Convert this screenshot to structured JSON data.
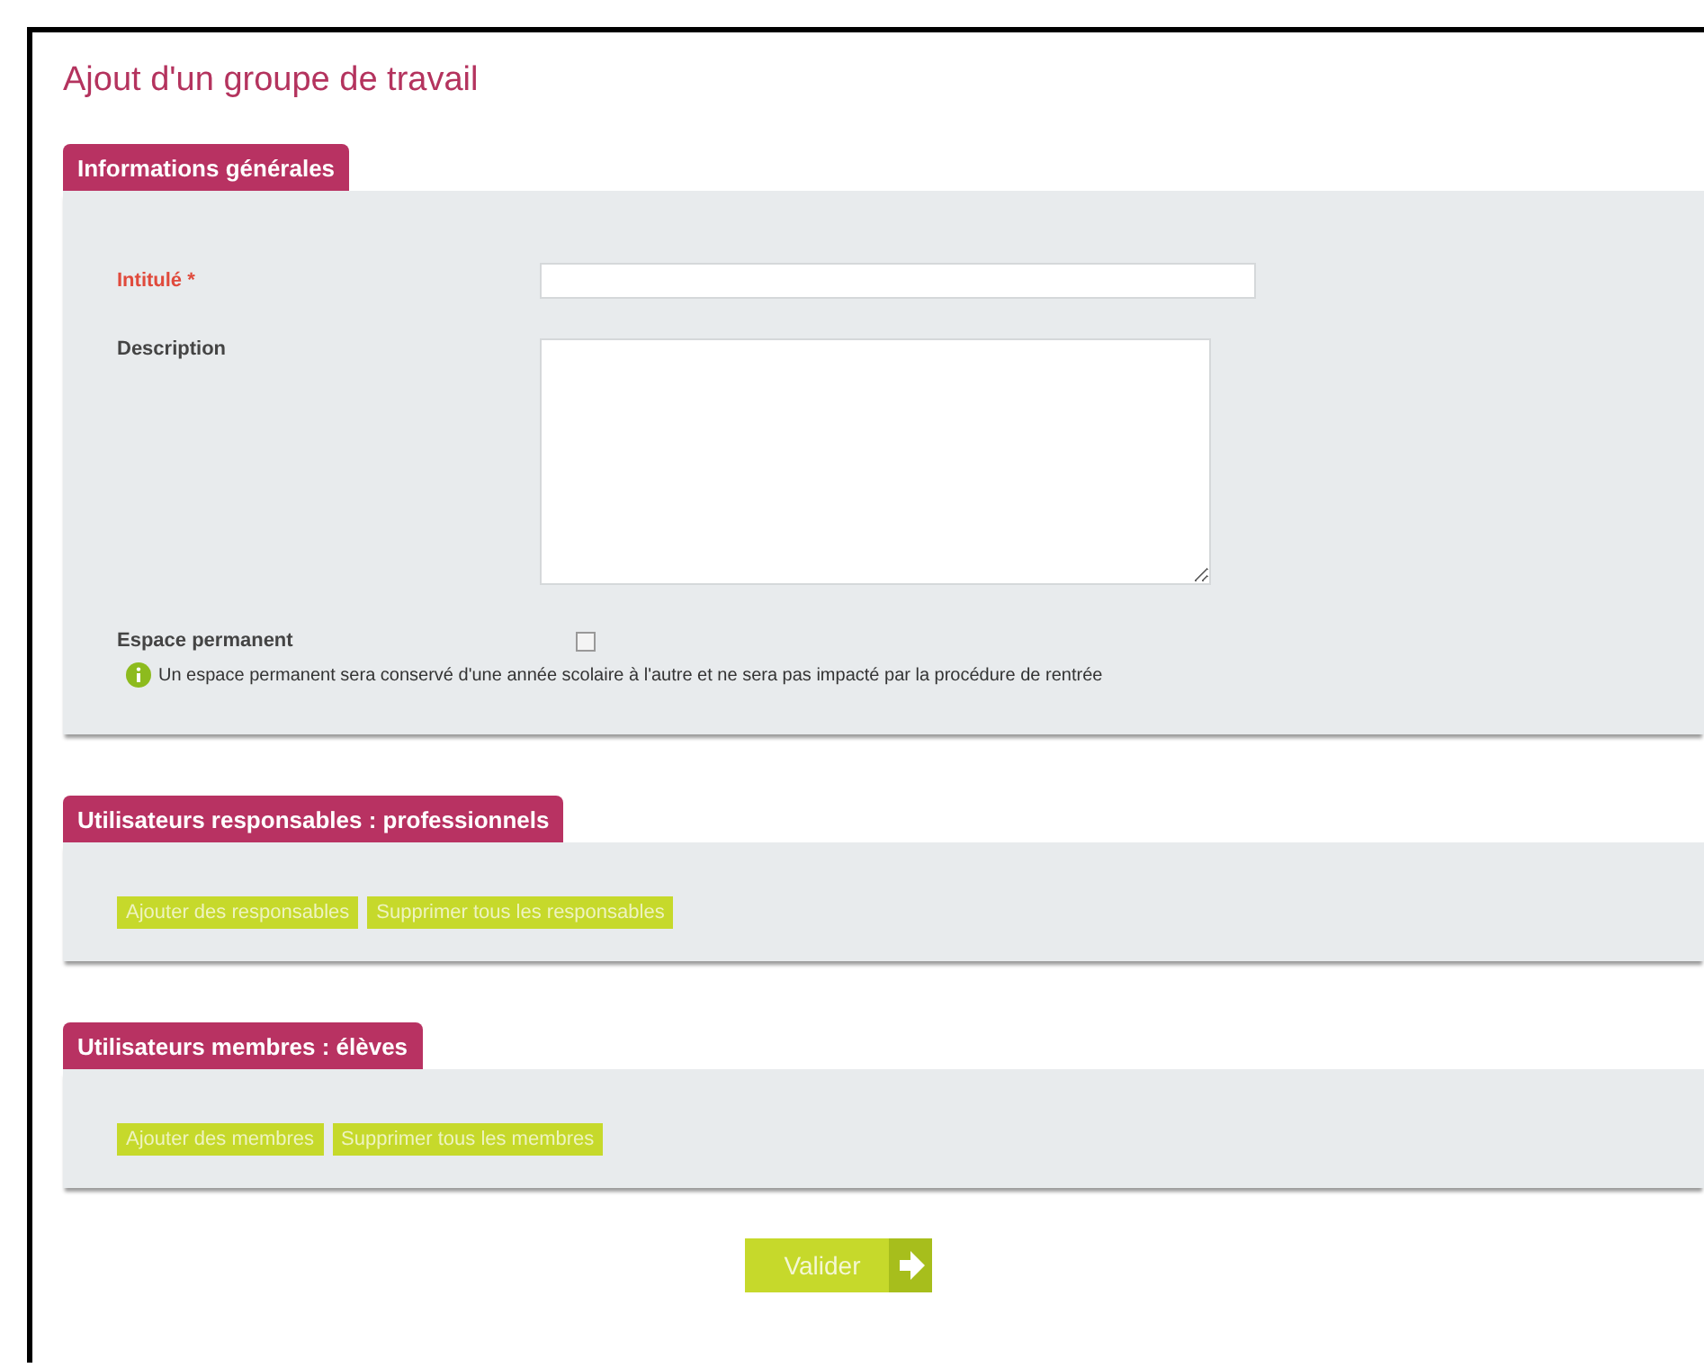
{
  "title": "Ajout d'un groupe de travail",
  "sections": [
    {
      "kind": "form",
      "heading": "Informations générales",
      "fields": [
        {
          "kind": "text",
          "label": "Intitulé *",
          "required": true
        },
        {
          "kind": "textarea",
          "label": "Description",
          "required": false
        },
        {
          "kind": "checkbox",
          "label": "Espace permanent",
          "required": false,
          "checked": false,
          "note": "Un espace permanent sera conservé d'une année scolaire à l'autre et ne sera pas impacté par la procédure de rentrée"
        }
      ]
    },
    {
      "kind": "buttons",
      "heading": "Utilisateurs responsables : professionnels",
      "buttons": [
        "Ajouter des responsables",
        "Supprimer tous les responsables"
      ]
    },
    {
      "kind": "buttons",
      "heading": "Utilisateurs membres : élèves",
      "buttons": [
        "Ajouter des membres",
        "Supprimer tous les membres"
      ]
    }
  ],
  "submit": "Valider"
}
